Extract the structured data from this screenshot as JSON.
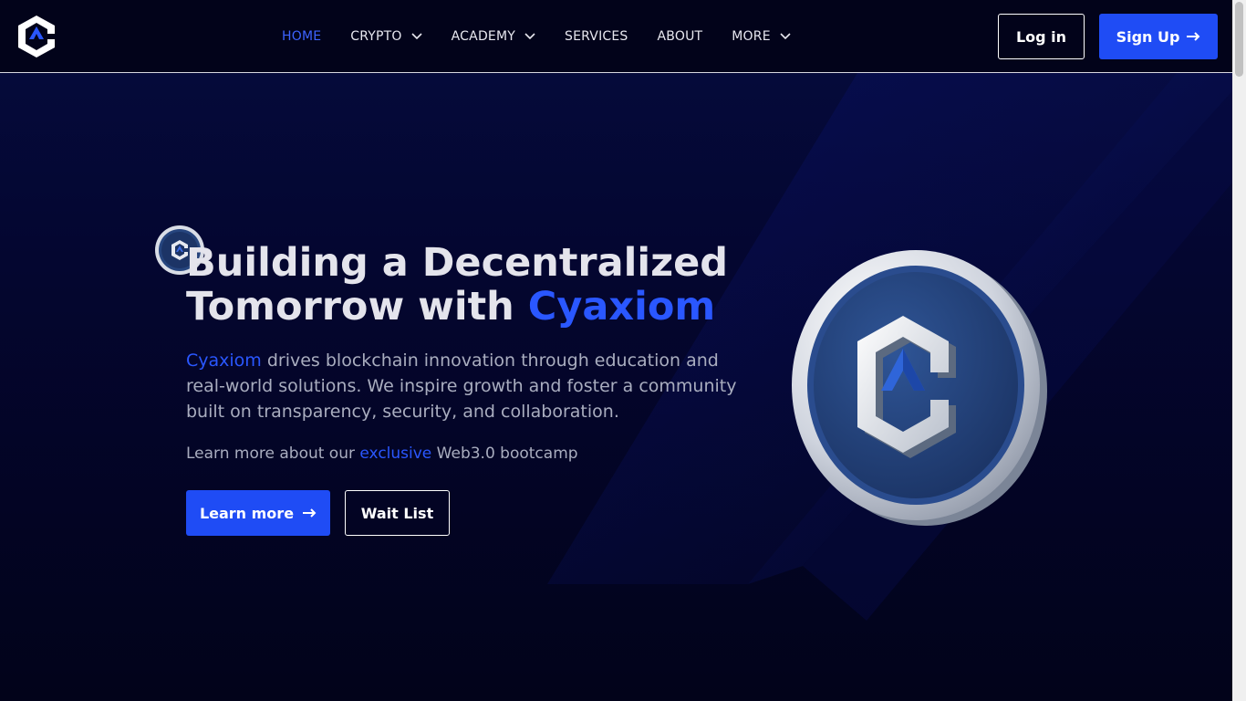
{
  "nav": {
    "items": [
      {
        "label": "HOME",
        "active": true,
        "dropdown": false
      },
      {
        "label": "CRYPTO",
        "active": false,
        "dropdown": true
      },
      {
        "label": "ACADEMY",
        "active": false,
        "dropdown": true
      },
      {
        "label": "SERVICES",
        "active": false,
        "dropdown": false
      },
      {
        "label": "ABOUT",
        "active": false,
        "dropdown": false
      },
      {
        "label": "MORE",
        "active": false,
        "dropdown": true
      }
    ],
    "login_label": "Log in",
    "signup_label": "Sign Up"
  },
  "hero": {
    "headline_line1": "Building a Decentralized",
    "headline_line2_prefix": "Tomorrow with ",
    "headline_brand": "Cyaxiom",
    "desc_brand": "Cyaxiom",
    "desc_text": " drives blockchain innovation through education and real-world solutions. We inspire growth and foster a community built on transparency, security, and collaboration.",
    "learn_prefix": "Learn more about our ",
    "learn_accent": "exclusive",
    "learn_suffix": " Web3.0 bootcamp",
    "learn_more_label": "Learn more",
    "wait_list_label": "Wait List"
  },
  "colors": {
    "accent": "#1f4cf5",
    "brand_text": "#2a57ff",
    "background": "#02031a"
  },
  "icons": [
    "cyaxiom-logo-icon",
    "chevron-down-icon",
    "arrow-right-icon",
    "coin-icon"
  ]
}
